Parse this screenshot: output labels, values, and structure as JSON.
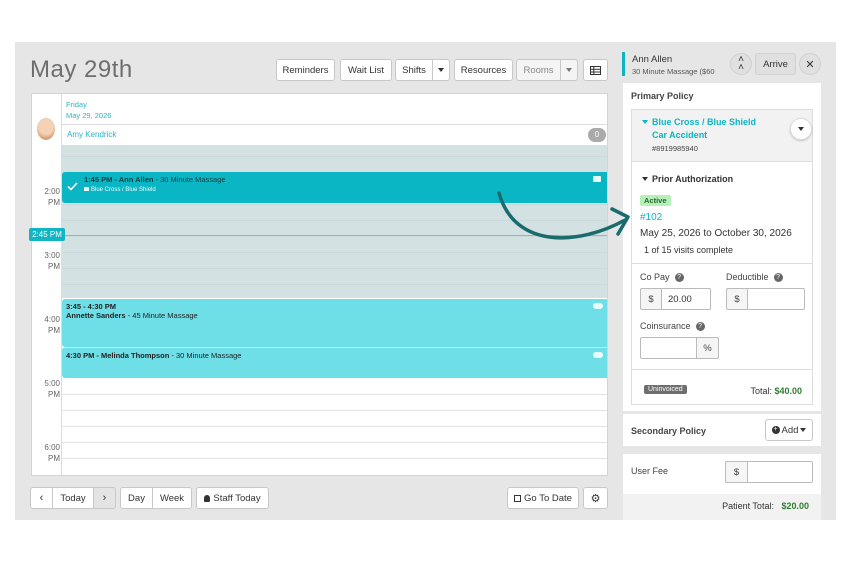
{
  "header": {
    "date_title": "May 29th",
    "buttons": {
      "reminders": "Reminders",
      "wait_list": "Wait List",
      "shifts": "Shifts",
      "resources": "Resources",
      "rooms": "Rooms"
    }
  },
  "calendar": {
    "day_name": "Friday",
    "day_date": "May 29, 2026",
    "staff_name": "Amy Kendrick",
    "staff_count": "0",
    "now_time": "2:45 PM",
    "hours": [
      {
        "hour": "2:00",
        "ampm": "PM"
      },
      {
        "hour": "3:00",
        "ampm": "PM"
      },
      {
        "hour": "4:00",
        "ampm": "PM"
      },
      {
        "hour": "5:00",
        "ampm": "PM"
      },
      {
        "hour": "6:00",
        "ampm": "PM"
      }
    ],
    "appointments": [
      {
        "time": "1:45 PM - Ann Allen",
        "service": " - 30 Minute Massage",
        "insurance": "Blue Cross / Blue Shield"
      },
      {
        "time": "3:45 - 4:30 PM",
        "client": "Annette Sanders",
        "service": " - 45 Minute Massage"
      },
      {
        "time": "4:30 PM - Melinda Thompson",
        "service": " - 30 Minute Massage"
      }
    ]
  },
  "footer": {
    "today": "Today",
    "day": "Day",
    "week": "Week",
    "staff_today": "Staff Today",
    "go_to_date": "Go To Date"
  },
  "panel": {
    "client_name": "Ann Allen",
    "client_service": "30 Minute Massage ($60",
    "arrive": "Arrive",
    "primary_policy": "Primary Policy",
    "insurer": "Blue Cross / Blue Shield",
    "case_type": "Car Accident",
    "policy_number": "#8919985940",
    "prior_auth": "Prior Authorization",
    "status": "Active",
    "auth_number": "#102",
    "date_range": "May 25, 2026 to October 30, 2026",
    "visits": "1 of 15 visits complete",
    "copay_label": "Co Pay",
    "copay_value": "20.00",
    "deductible_label": "Deductible",
    "coinsurance_label": "Coinsurance",
    "currency": "$",
    "percent": "%",
    "uninvoiced": "Uninvoiced",
    "total_label": "Total:",
    "total_value": "$40.00",
    "secondary_policy": "Secondary Policy",
    "add": "Add",
    "user_fee": "User Fee",
    "patient_total_label": "Patient Total:",
    "patient_total_value": "$20.00"
  },
  "colors": {
    "teal": "#0bb6c4",
    "light_teal": "#6fdfe7",
    "blocked": "#d3e1e3",
    "active_badge": "#b6efb9",
    "arrow": "#196b6d",
    "total_green": "#2e7d32"
  }
}
